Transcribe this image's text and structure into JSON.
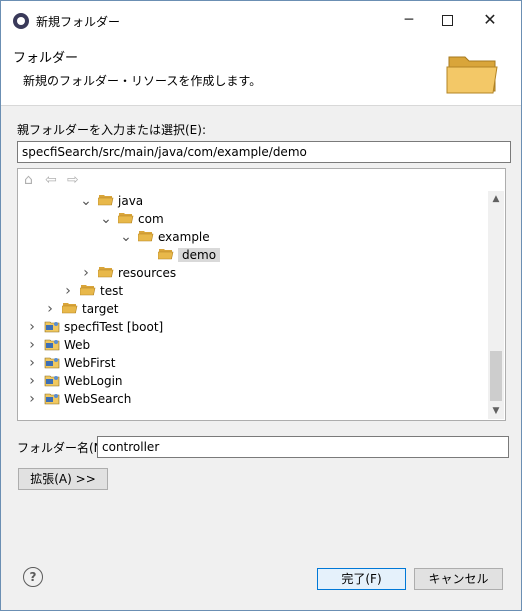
{
  "window": {
    "title": "新規フォルダー"
  },
  "titlebar": {
    "minimize": "─",
    "close": "✕"
  },
  "header": {
    "title": "フォルダー",
    "description": "新規のフォルダー・リソースを作成します。"
  },
  "parent_folder": {
    "label": "親フォルダーを入力または選択(E):",
    "value": "specfiSearch/src/main/java/com/example/demo"
  },
  "tree_toolbar": {
    "home_icon": "⌂",
    "back_icon": "⇦",
    "forward_icon": "⇨"
  },
  "tree": {
    "items": [
      {
        "label": "java",
        "state": "expanded",
        "icon": "folder-open-icon"
      },
      {
        "label": "com",
        "state": "expanded",
        "icon": "folder-open-icon"
      },
      {
        "label": "example",
        "state": "expanded",
        "icon": "folder-open-icon"
      },
      {
        "label": "demo",
        "state": "leaf",
        "icon": "folder-open-icon",
        "selected": true
      },
      {
        "label": "resources",
        "state": "collapsed",
        "icon": "folder-open-icon"
      },
      {
        "label": "test",
        "state": "collapsed",
        "icon": "folder-open-icon"
      },
      {
        "label": "target",
        "state": "collapsed",
        "icon": "folder-open-icon"
      },
      {
        "label": "specfiTest [boot]",
        "state": "collapsed",
        "icon": "maven-project-icon"
      },
      {
        "label": "Web",
        "state": "collapsed",
        "icon": "project-icon"
      },
      {
        "label": "WebFirst",
        "state": "collapsed",
        "icon": "project-icon"
      },
      {
        "label": "WebLogin",
        "state": "collapsed",
        "icon": "project-icon"
      },
      {
        "label": "WebSearch",
        "state": "collapsed",
        "icon": "project-icon"
      }
    ]
  },
  "scrollbar": {
    "up": "▲",
    "down": "▼"
  },
  "folder_name": {
    "label": "フォルダー名(N):",
    "value": "controller"
  },
  "buttons": {
    "advanced": "拡張(A) >>",
    "finish": "完了(F)",
    "cancel": "キャンセル"
  },
  "help": {
    "glyph": "?"
  },
  "colors": {
    "accent": "#0078d7",
    "folder": "#e8b84a",
    "selected_bg": "#d9d9d9"
  }
}
